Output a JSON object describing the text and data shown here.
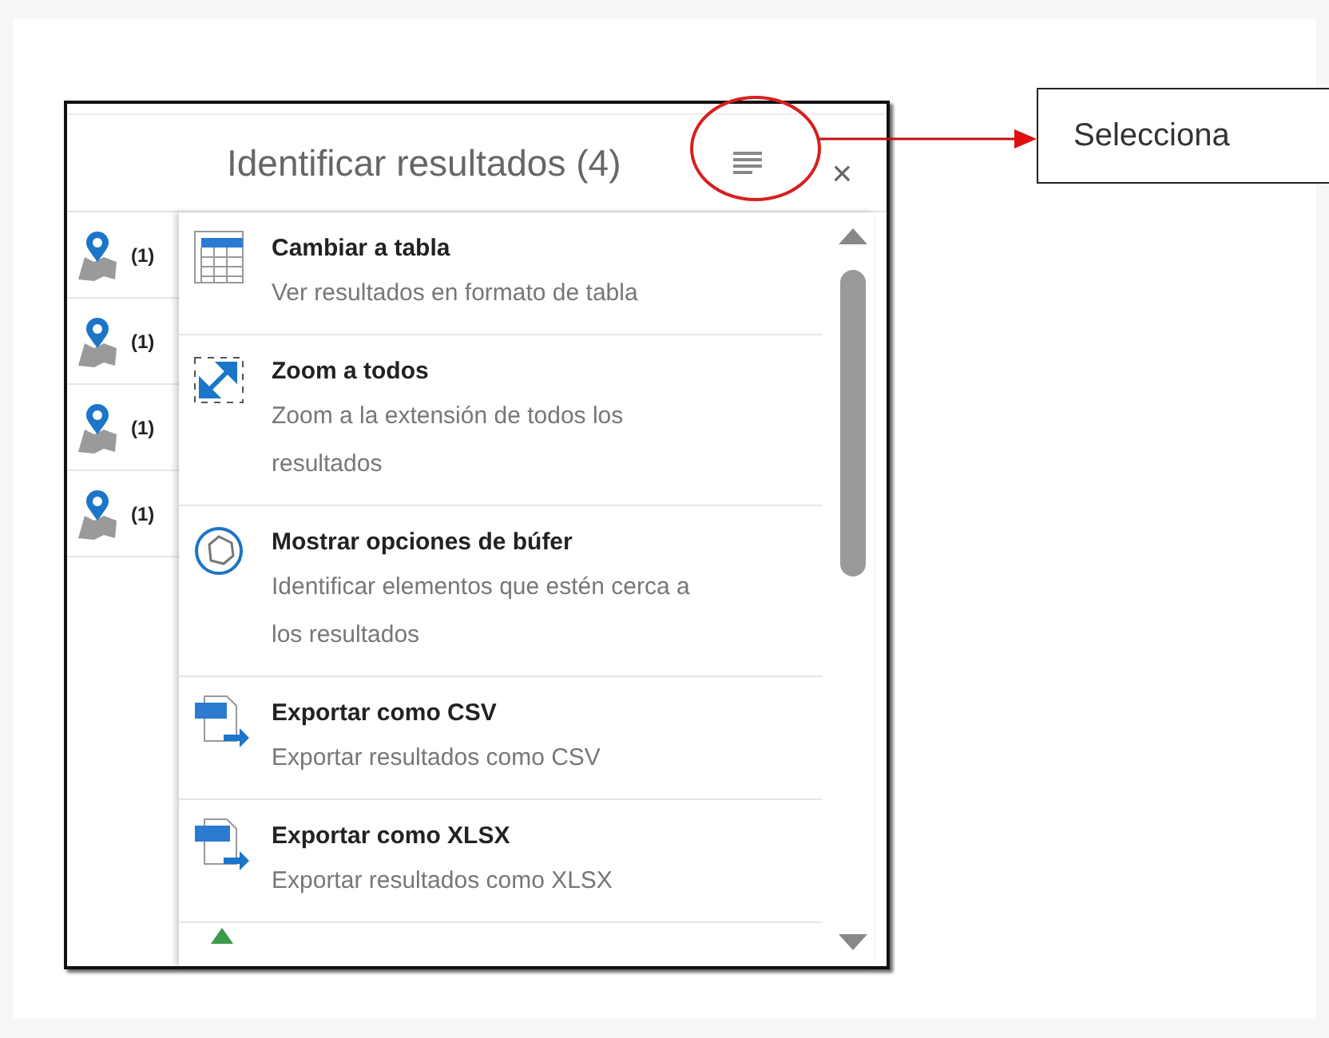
{
  "panel": {
    "title": "Identificar resultados (4)",
    "close_symbol": "×",
    "results": [
      {
        "count": "(1)"
      },
      {
        "count": "(1)"
      },
      {
        "count": "(1)"
      },
      {
        "count": "(1)"
      }
    ]
  },
  "menu": {
    "items": [
      {
        "kind": "table",
        "title": "Cambiar a tabla",
        "description": "Ver resultados en formato de tabla"
      },
      {
        "kind": "zoom",
        "title": "Zoom a todos",
        "description": "Zoom a la extensión de todos los resultados"
      },
      {
        "kind": "buffer",
        "title": "Mostrar opciones de búfer",
        "description": "Identificar elementos que estén cerca a los resultados"
      },
      {
        "kind": "csv",
        "title": "Exportar como CSV",
        "description": "Exportar resultados como CSV"
      },
      {
        "kind": "xlsx",
        "title": "Exportar como XLSX",
        "description": "Exportar resultados como XLSX"
      }
    ]
  },
  "annotation": {
    "label": "Selecciona"
  }
}
